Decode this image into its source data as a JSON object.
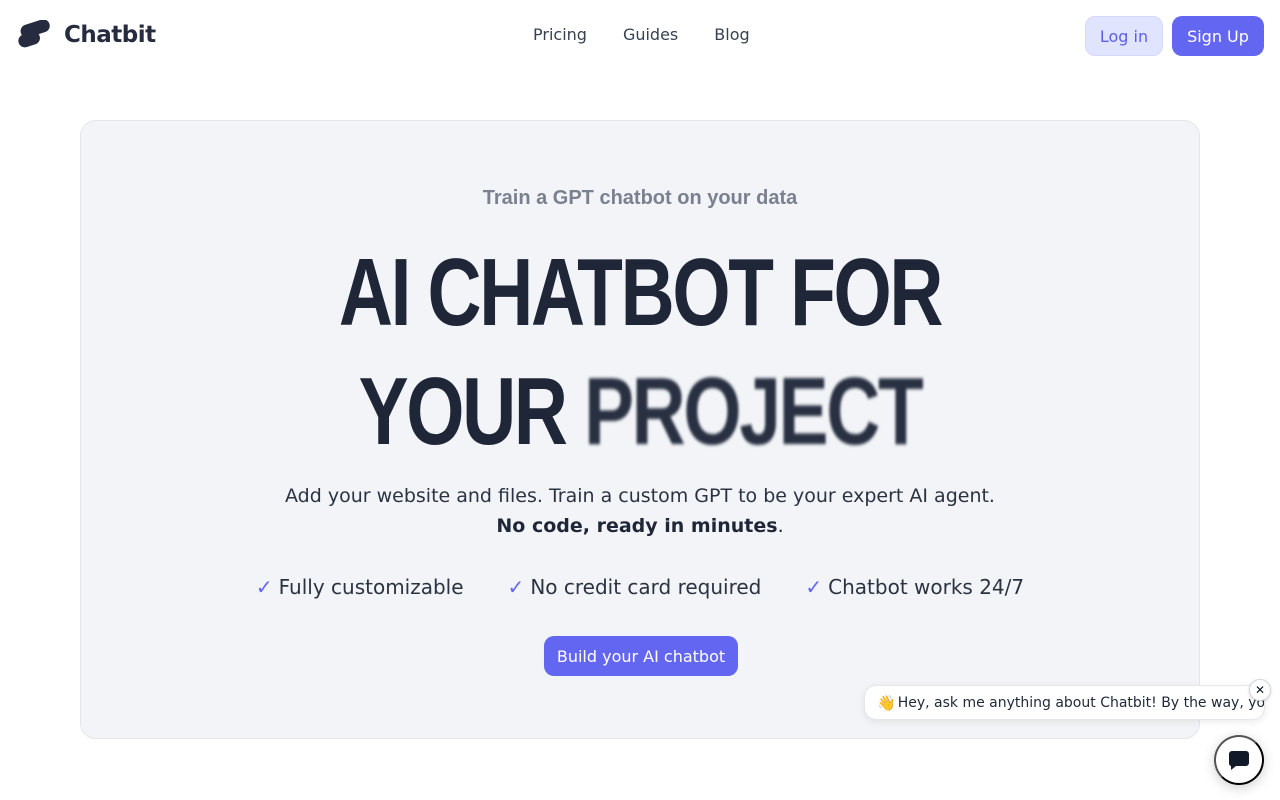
{
  "brand": {
    "name": "Chatbit",
    "color": "#272b3f"
  },
  "nav": {
    "links": [
      {
        "label": "Pricing"
      },
      {
        "label": "Guides"
      },
      {
        "label": "Blog"
      }
    ],
    "login_label": "Log in",
    "signup_label": "Sign Up"
  },
  "hero": {
    "kicker": "Train a GPT chatbot on your data",
    "headline_line1": "AI CHATBOT FOR",
    "headline_line2_prefix": "YOUR",
    "headline_line2_word": "PROJECT",
    "subtitle": "Add your website and files. Train a custom GPT to be your expert AI agent.",
    "subtitle_bold": "No code, ready in minutes",
    "subtitle_end": ".",
    "features": [
      {
        "icon": "check-icon",
        "label": "Fully customizable"
      },
      {
        "icon": "check-icon",
        "label": "No credit card required"
      },
      {
        "icon": "check-icon",
        "label": "Chatbot works 24/7"
      }
    ],
    "cta_label": "Build your AI chatbot"
  },
  "chat_widget": {
    "wave": "👋",
    "message": "Hey, ask me anything about Chatbit! By the way, yo...",
    "close_glyph": "✕"
  },
  "colors": {
    "accent": "#6366f1",
    "hero_bg": "#f2f4f7",
    "heading": "#1e2638"
  }
}
